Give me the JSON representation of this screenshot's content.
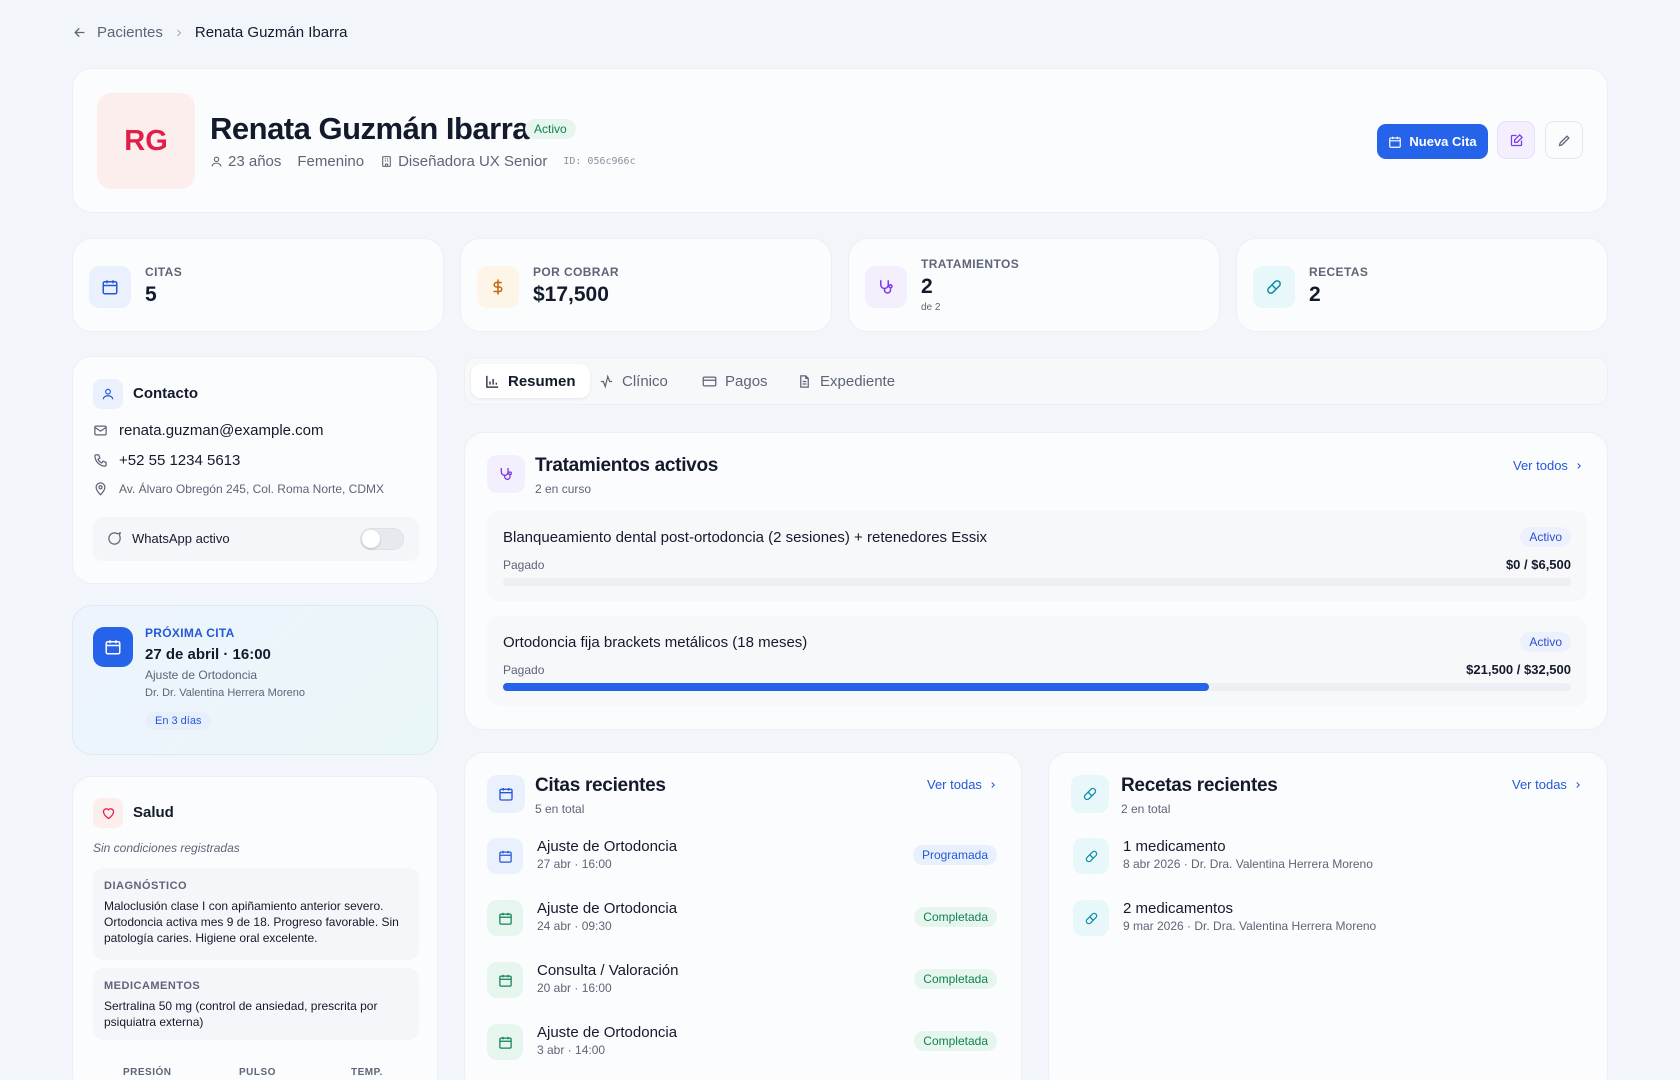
{
  "breadcrumb": {
    "parent": "Pacientes",
    "current": "Renata Guzmán Ibarra"
  },
  "header": {
    "initials": "RG",
    "name": "Renata Guzmán Ibarra",
    "status": "Activo",
    "age": "23 años",
    "gender": "Femenino",
    "occupation": "Diseñadora UX Senior",
    "id_text": "ID: 056c966c",
    "new_appointment_label": "Nueva Cita"
  },
  "stats": [
    {
      "label": "CITAS",
      "value": "5",
      "sub": "",
      "icon": "calendar-icon"
    },
    {
      "label": "POR COBRAR",
      "value": "$17,500",
      "sub": "",
      "icon": "dollar-icon"
    },
    {
      "label": "TRATAMIENTOS",
      "value": "2",
      "sub": "de 2",
      "icon": "stethoscope-icon"
    },
    {
      "label": "RECETAS",
      "value": "2",
      "sub": "",
      "icon": "pill-icon"
    }
  ],
  "contact": {
    "title": "Contacto",
    "email": "renata.guzman@example.com",
    "phone": "+52 55 1234 5613",
    "address": "Av. Álvaro Obregón 245, Col. Roma Norte, CDMX",
    "whatsapp_label": "WhatsApp activo",
    "whatsapp_on": false
  },
  "next_appointment": {
    "label": "PRÓXIMA CITA",
    "date": "27 de abril · 16:00",
    "type": "Ajuste de Ortodoncia",
    "doctor": "Dr. Dr. Valentina Herrera Moreno",
    "relative": "En 3 días"
  },
  "health": {
    "title": "Salud",
    "conditions": "Sin condiciones registradas",
    "diagnosis_label": "DIAGNÓSTICO",
    "diagnosis": "Maloclusión clase I con apiñamiento anterior severo. Ortodoncia activa mes 9 de 18. Progreso favorable. Sin patología caries. Higiene oral excelente.",
    "meds_label": "MEDICAMENTOS",
    "meds": "Sertralina 50 mg (control de ansiedad, prescrita por psiquiatra externa)",
    "vitals": [
      "PRESIÓN",
      "PULSO",
      "TEMP."
    ]
  },
  "tabs": [
    {
      "label": "Resumen",
      "icon": "bar-chart-icon",
      "active": true
    },
    {
      "label": "Clínico",
      "icon": "activity-icon",
      "active": false
    },
    {
      "label": "Pagos",
      "icon": "credit-card-icon",
      "active": false
    },
    {
      "label": "Expediente",
      "icon": "file-icon",
      "active": false
    }
  ],
  "treatments": {
    "title": "Tratamientos activos",
    "subtitle": "2 en curso",
    "link": "Ver todos",
    "items": [
      {
        "name": "Blanqueamiento dental post-ortodoncia (2 sesiones) + retenedores Essix",
        "status": "Activo",
        "paid_label": "Pagado",
        "amount": "$0 / $6,500",
        "progress": 0
      },
      {
        "name": "Ortodoncia fija brackets metálicos (18 meses)",
        "status": "Activo",
        "paid_label": "Pagado",
        "amount": "$21,500 / $32,500",
        "progress": 0.6615
      }
    ]
  },
  "appointments": {
    "title": "Citas recientes",
    "subtitle": "5 en total",
    "link": "Ver todas",
    "items": [
      {
        "name": "Ajuste de Ortodoncia",
        "when": "27 abr · 16:00",
        "status": "Programada",
        "color": "#2458d8"
      },
      {
        "name": "Ajuste de Ortodoncia",
        "when": "24 abr · 09:30",
        "status": "Completada",
        "color": "#128151"
      },
      {
        "name": "Consulta / Valoración",
        "when": "20 abr · 16:00",
        "status": "Completada",
        "color": "#128151"
      },
      {
        "name": "Ajuste de Ortodoncia",
        "when": "3 abr · 14:00",
        "status": "Completada",
        "color": "#128151"
      }
    ]
  },
  "prescriptions": {
    "title": "Recetas recientes",
    "subtitle": "2 en total",
    "link": "Ver todas",
    "items": [
      {
        "name": "1 medicamento",
        "meta": "8 abr 2026 · Dr. Dra. Valentina Herrera Moreno"
      },
      {
        "name": "2 medicamentos",
        "meta": "9 mar 2026 · Dr. Dra. Valentina Herrera Moreno"
      }
    ]
  },
  "colors": {
    "primary": "#2563eb",
    "accent_red": "#e11d48",
    "success": "#128151"
  }
}
